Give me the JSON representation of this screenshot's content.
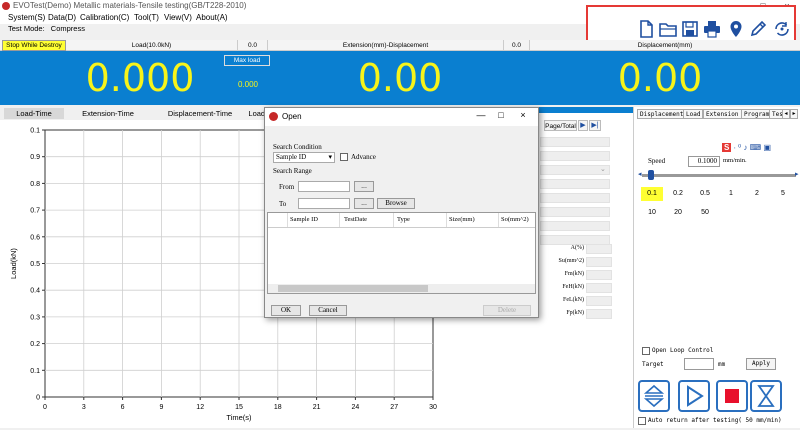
{
  "window": {
    "title": "EVOTest(Demo) Metallic materials-Tensile testing(GB/T228-2010)",
    "controls": [
      "—",
      "□",
      "×"
    ]
  },
  "menu": [
    "System(S)",
    "Data(D)",
    "Calibration(C)",
    "Tool(T)",
    "View(V)",
    "About(A)"
  ],
  "test_mode": {
    "label": "Test Mode:",
    "value": "Compress"
  },
  "toolbar": {
    "icons": [
      "new-file-icon",
      "open-folder-icon",
      "save-icon",
      "print-icon",
      "location-pin-icon",
      "pencil-icon",
      "refresh-icon"
    ]
  },
  "header": {
    "stop_button": "Stop While Destroy",
    "load_label": "Load(10.0kN)",
    "load_value": "0.0",
    "ext_label": "Extension(mm)-Displacement",
    "ext_value": "0.0",
    "disp_label": "Displacement(mm)"
  },
  "readouts": {
    "load": "0.000",
    "max_load_label": "Max load",
    "max_load_value": "0.000",
    "extension": "0.00",
    "displacement": "0.00"
  },
  "tabs": [
    "Load-Time",
    "Extension-Time",
    "Displacement-Time",
    "Load-"
  ],
  "chart_data": {
    "type": "line",
    "xlabel": "Time(s)",
    "ylabel": "Load(kN)",
    "x_ticks": [
      "0",
      "3",
      "6",
      "9",
      "12",
      "15",
      "18",
      "21",
      "24",
      "27",
      "30"
    ],
    "y_ticks": [
      "0",
      "0.1",
      "0.2",
      "0.3",
      "0.4",
      "0.5",
      "0.6",
      "0.7",
      "0.8",
      "0.9",
      "0.1"
    ],
    "xlim": [
      0,
      30
    ],
    "ylim": [
      0,
      1
    ],
    "grid": true,
    "series": []
  },
  "mid": {
    "page_total": "Page/Total",
    "labels": [
      "A(%)",
      "Su(mm^2)",
      "Fm(kN)",
      "FeH(kN)",
      "FeL(kN)",
      "Fp(kN)"
    ]
  },
  "right": {
    "tabs": [
      "Displacement",
      "Load",
      "Extension",
      "Program",
      "Tes"
    ],
    "speed_label": "Speed",
    "speed_value": "0.1000",
    "speed_unit": "mm/min.",
    "speed_options": [
      "0.1",
      "0.2",
      "0.5",
      "1",
      "2",
      "5",
      "10",
      "20",
      "50"
    ],
    "open_loop": "Open Loop Control",
    "target_label": "Target",
    "target_unit": "mm",
    "apply": "Apply",
    "auto_return": "Auto return after testing( 50  mm/min)"
  },
  "dialog": {
    "title": "Open",
    "search_condition": "Search Condition",
    "sample_select": "Sample ID",
    "advance": "Advance",
    "search_range": "Search Range",
    "from": "From",
    "to": "To",
    "ellipsis": "...",
    "browse": "Browse",
    "columns": [
      "Sample ID",
      "TestDate",
      "Type",
      "Size(mm)",
      "So(mm^2)"
    ],
    "ok": "OK",
    "cancel": "Cancel",
    "delete": "Delete"
  },
  "colors": {
    "accent_blue": "#0a7fd0",
    "readout_yellow": "#f7f41a",
    "highlight_red": "#e53935",
    "stop_record": "#e8102c"
  }
}
